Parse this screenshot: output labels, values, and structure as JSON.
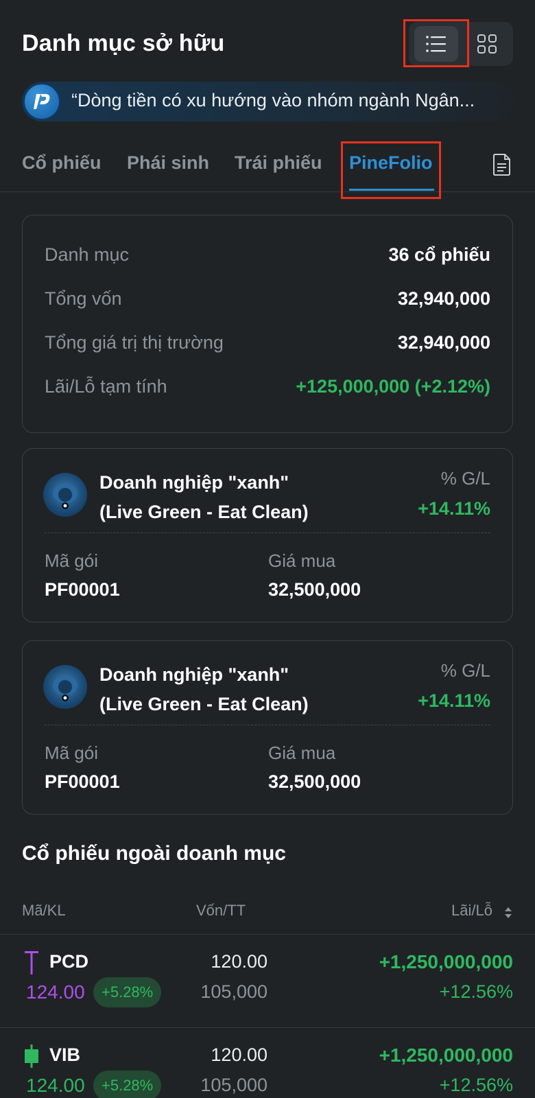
{
  "header": {
    "title": "Danh mục sở hữu"
  },
  "view_toggle": {
    "list_icon": "list-icon",
    "grid_icon": "grid-icon",
    "active": "list"
  },
  "news": {
    "text": "“Dòng tiền có xu hướng vào nhóm ngành Ngân..."
  },
  "tabs": [
    {
      "label": "Cổ phiếu"
    },
    {
      "label": "Phái sinh"
    },
    {
      "label": "Trái phiếu"
    },
    {
      "label": "PineFolio",
      "active": true
    }
  ],
  "summary": {
    "rows": [
      {
        "label": "Danh mục",
        "value": "36 cổ phiếu"
      },
      {
        "label": "Tổng vốn",
        "value": "32,940,000"
      },
      {
        "label": "Tổng giá trị thị trường",
        "value": "32,940,000"
      },
      {
        "label": "Lãi/Lỗ tạm tính",
        "value": "+125,000,000 (+2.12%)"
      }
    ]
  },
  "packages": [
    {
      "title_line1": "Doanh nghiệp \"xanh\"",
      "title_line2": "(Live Green - Eat Clean)",
      "gl_label": "% G/L",
      "gl_value": "+14.11%",
      "code_label": "Mã gói",
      "code": "PF00001",
      "price_label": "Giá mua",
      "price": "32,500,000"
    },
    {
      "title_line1": "Doanh nghiệp \"xanh\"",
      "title_line2": "(Live Green - Eat Clean)",
      "gl_label": "% G/L",
      "gl_value": "+14.11%",
      "code_label": "Mã gói",
      "code": "PF00001",
      "price_label": "Giá mua",
      "price": "32,500,000"
    }
  ],
  "outside": {
    "title": "Cổ phiếu ngoài doanh mục",
    "headers": {
      "symbol": "Mã/KL",
      "cost": "Vốn/TT",
      "pl": "Lãi/Lỗ"
    },
    "rows": [
      {
        "symbol": "PCD",
        "price": "124.00",
        "change": "+5.28%",
        "volume": "120.00",
        "market": "105,000",
        "pl": "+1,250,000,000",
        "pl_pct": "+12.56%",
        "color": "#b04ee8"
      },
      {
        "symbol": "VIB",
        "price": "124.00",
        "change": "+5.28%",
        "volume": "120.00",
        "market": "105,000",
        "pl": "+1,250,000,000",
        "pl_pct": "+12.56%",
        "color": "#2fb85f"
      }
    ]
  },
  "colors": {
    "accent": "#2e8fd6",
    "positive": "#2fb85f",
    "ceiling": "#b04ee8",
    "highlight": "#e8321e"
  }
}
